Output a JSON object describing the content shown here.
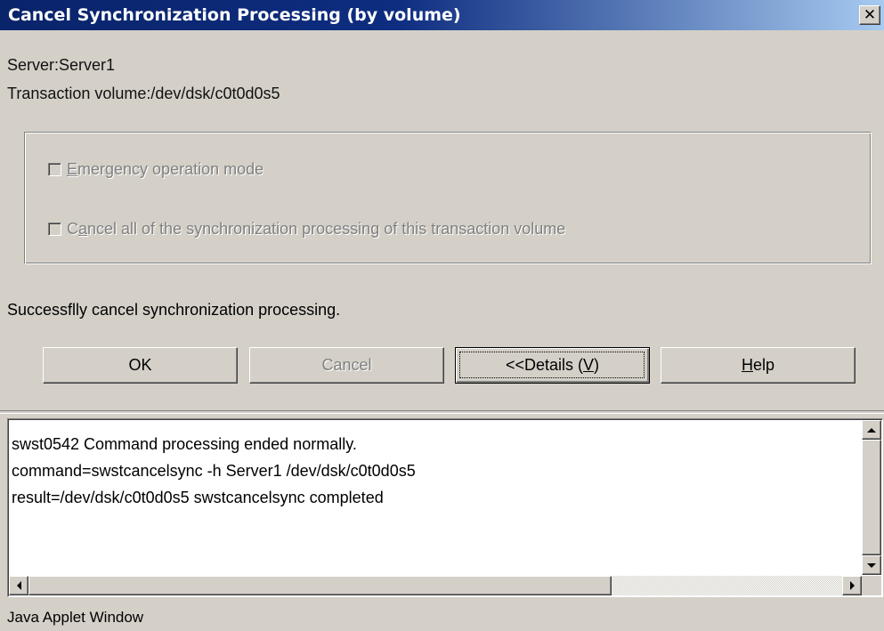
{
  "window": {
    "title": "Cancel Synchronization Processing (by volume)",
    "close_glyph": "✕"
  },
  "info": {
    "server": "Server:Server1",
    "volume": "Transaction volume:/dev/dsk/c0t0d0s5"
  },
  "options": {
    "emergency": {
      "pre": "",
      "mnemonic": "E",
      "post": "mergency operation mode",
      "checked": false,
      "enabled": false
    },
    "cancel_all": {
      "pre": "C",
      "mnemonic": "a",
      "post": "ncel all of the synchronization processing of this transaction volume",
      "checked": false,
      "enabled": false
    }
  },
  "status_message": "Successflly cancel synchronization processing.",
  "buttons": {
    "ok": "OK",
    "cancel": "Cancel",
    "details_pre": "<<Details (",
    "details_mnemonic": "V",
    "details_post": ")",
    "help_mnemonic": "H",
    "help_post": "elp"
  },
  "details": {
    "lines": [
      "swst0542 Command processing ended normally.",
      "command=swstcancelsync -h Server1 /dev/dsk/c0t0d0s5",
      "result=/dev/dsk/c0t0d0s5 swstcancelsync completed"
    ]
  },
  "footer": "Java Applet Window",
  "colors": {
    "title_start": "#0a246a",
    "title_end": "#a6caf0",
    "dialog_bg": "#d4d0c8",
    "disabled_text": "#808080"
  }
}
